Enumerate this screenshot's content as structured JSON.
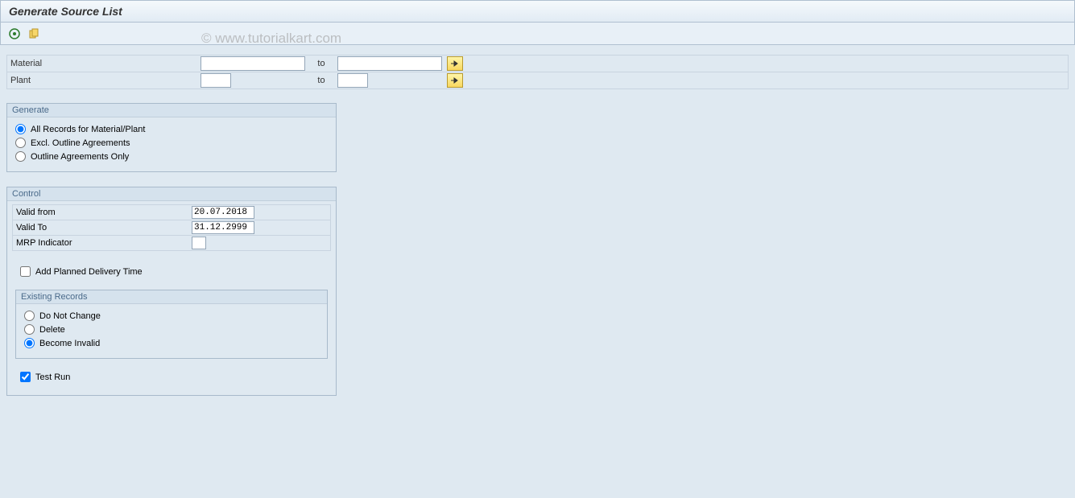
{
  "title": "Generate Source List",
  "watermark": "© www.tutorialkart.com",
  "toolbar": {
    "execute_icon": "execute-icon",
    "variant_icon": "variant-icon"
  },
  "selection": {
    "material": {
      "label": "Material",
      "from": "",
      "to_label": "to",
      "to": ""
    },
    "plant": {
      "label": "Plant",
      "from": "",
      "to_label": "to",
      "to": ""
    }
  },
  "generate": {
    "title": "Generate",
    "options": [
      {
        "label": "All Records for Material/Plant",
        "checked": true
      },
      {
        "label": "Excl. Outline Agreements",
        "checked": false
      },
      {
        "label": "Outline Agreements Only",
        "checked": false
      }
    ]
  },
  "control": {
    "title": "Control",
    "valid_from": {
      "label": "Valid from",
      "value": "20.07.2018"
    },
    "valid_to": {
      "label": "Valid To",
      "value": "31.12.2999"
    },
    "mrp": {
      "label": "MRP Indicator",
      "value": ""
    },
    "add_planned": {
      "label": "Add Planned Delivery Time",
      "checked": false
    },
    "existing": {
      "title": "Existing Records",
      "options": [
        {
          "label": "Do Not Change",
          "checked": false
        },
        {
          "label": "Delete",
          "checked": false
        },
        {
          "label": "Become Invalid",
          "checked": true
        }
      ]
    },
    "test_run": {
      "label": "Test Run",
      "checked": true
    }
  }
}
